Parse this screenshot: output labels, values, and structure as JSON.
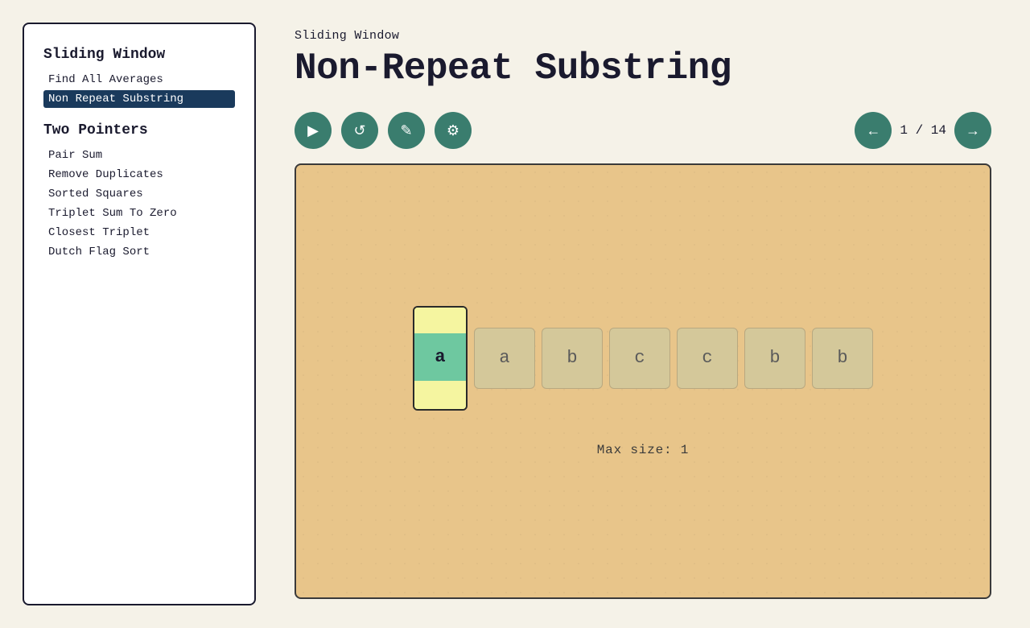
{
  "sidebar": {
    "sections": [
      {
        "title": "Sliding Window",
        "items": [
          {
            "label": "Find All Averages",
            "active": false
          },
          {
            "label": "Non Repeat Substring",
            "active": true
          }
        ]
      },
      {
        "title": "Two Pointers",
        "items": [
          {
            "label": "Pair Sum",
            "active": false
          },
          {
            "label": "Remove Duplicates",
            "active": false
          },
          {
            "label": "Sorted Squares",
            "active": false
          },
          {
            "label": "Triplet Sum To Zero",
            "active": false
          },
          {
            "label": "Closest Triplet",
            "active": false
          },
          {
            "label": "Dutch Flag Sort",
            "active": false
          }
        ]
      }
    ]
  },
  "main": {
    "breadcrumb": "Sliding Window",
    "title": "Non-Repeat Substring",
    "controls": {
      "play_icon": "▶",
      "reset_icon": "↺",
      "edit_icon": "✎",
      "settings_icon": "⚙",
      "prev_icon": "←",
      "next_icon": "→",
      "page_current": "1",
      "page_total": "14",
      "page_separator": "/"
    },
    "array": {
      "window_char": "a",
      "cells": [
        "a",
        "b",
        "c",
        "c",
        "b",
        "b"
      ]
    },
    "max_size_label": "Max size: 1"
  }
}
